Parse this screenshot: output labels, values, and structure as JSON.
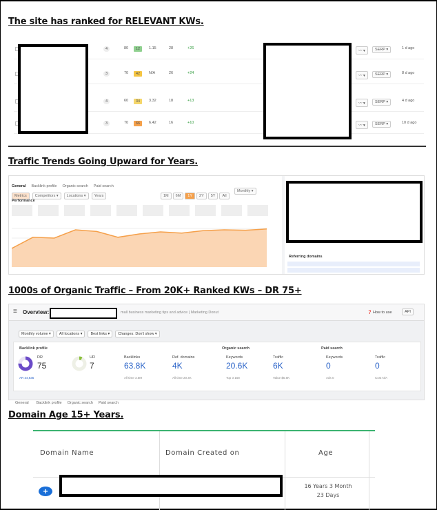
{
  "sections": {
    "kw_heading": "The site has ranked for RELEVANT KWs.",
    "traffic_heading": "Traffic Trends Going Upward for Years.",
    "organic_heading": "1000s of Organic Traffic – From 20K+ Ranked KWs – DR 75+",
    "age_heading": "Domain Age 15+ Years."
  },
  "keyword_rows": [
    {
      "pos": "4",
      "volume": "80",
      "kd": "12",
      "kd_color": "#8fd08f",
      "cpc": "1.15",
      "traffic": "28",
      "change": "+26",
      "updated": "1 d ago"
    },
    {
      "pos": "3",
      "volume": "70",
      "kd": "42",
      "kd_color": "#f5c542",
      "cpc": "N/A",
      "traffic": "26",
      "change": "+24",
      "updated": "8 d ago"
    },
    {
      "pos": "4",
      "volume": "60",
      "kd": "34",
      "kd_color": "#f5d66a",
      "cpc": "3.32",
      "traffic": "18",
      "change": "+13",
      "updated": "4 d ago"
    },
    {
      "pos": "3",
      "volume": "70",
      "kd": "66",
      "kd_color": "#f5a04a",
      "cpc": "6.42",
      "traffic": "16",
      "change": "+10",
      "updated": "10 d ago"
    }
  ],
  "serp_label": "SERP ▾",
  "traffic_panel": {
    "tabs": [
      "General",
      "Backlink profile",
      "Organic search",
      "Paid search"
    ],
    "filters": [
      "Metrics",
      "Competitors ▾",
      "Locations ▾",
      "Years"
    ],
    "ranges": [
      "1M",
      "6M",
      "1Y",
      "2Y",
      "5Y",
      "All"
    ],
    "interval": "Monthly ▾",
    "performance_label": "Performance",
    "referring_label": "Referring domains"
  },
  "traffic_chart": {
    "type": "area",
    "values": [
      0.45,
      0.72,
      0.7,
      0.9,
      0.86,
      0.72,
      0.8,
      0.85,
      0.82,
      0.88,
      0.9,
      0.89,
      0.92
    ],
    "color": "#f5a04a"
  },
  "overview": {
    "title": "Overview:",
    "subtitle": "mall business marketing tips and advice | Marketing Donut",
    "how_to_use": "How to use",
    "api": "API",
    "controls": [
      "Monthly volume ▾",
      "All locations ▾",
      "Best links ▾",
      "Changes: Don't show ▾"
    ],
    "backlink_profile": "Backlink profile",
    "organic_search": "Organic search",
    "paid_search": "Paid search",
    "metrics": {
      "dr_label": "DR",
      "dr_value": "75",
      "dr_sub": "AR 34,635",
      "ur_label": "UR",
      "ur_value": "7",
      "backlinks_label": "Backlinks",
      "backlinks_value": "63.8K",
      "backlinks_sub": "All time 3.5M",
      "refdomains_label": "Ref. domains",
      "refdomains_value": "4K",
      "refdomains_sub": "All time 20.4K",
      "keywords_label": "Keywords",
      "keywords_value": "20.6K",
      "keywords_sub": "Top 3 158",
      "traffic_label": "Traffic",
      "traffic_value": "6K",
      "traffic_sub": "Value $5.6K",
      "paid_keywords_label": "Keywords",
      "paid_keywords_value": "0",
      "paid_keywords_sub": "Ads 0",
      "paid_traffic_label": "Traffic",
      "paid_traffic_value": "0",
      "paid_traffic_sub": "Cost N/A"
    },
    "bottom_tabs": [
      "General",
      "Backlink profile",
      "Organic search",
      "Paid search"
    ]
  },
  "domain_table": {
    "col_name": "Domain Name",
    "col_created": "Domain Created on",
    "col_age": "Age",
    "age_line1": "16 Years 3 Month",
    "age_line2": "23 Days"
  }
}
